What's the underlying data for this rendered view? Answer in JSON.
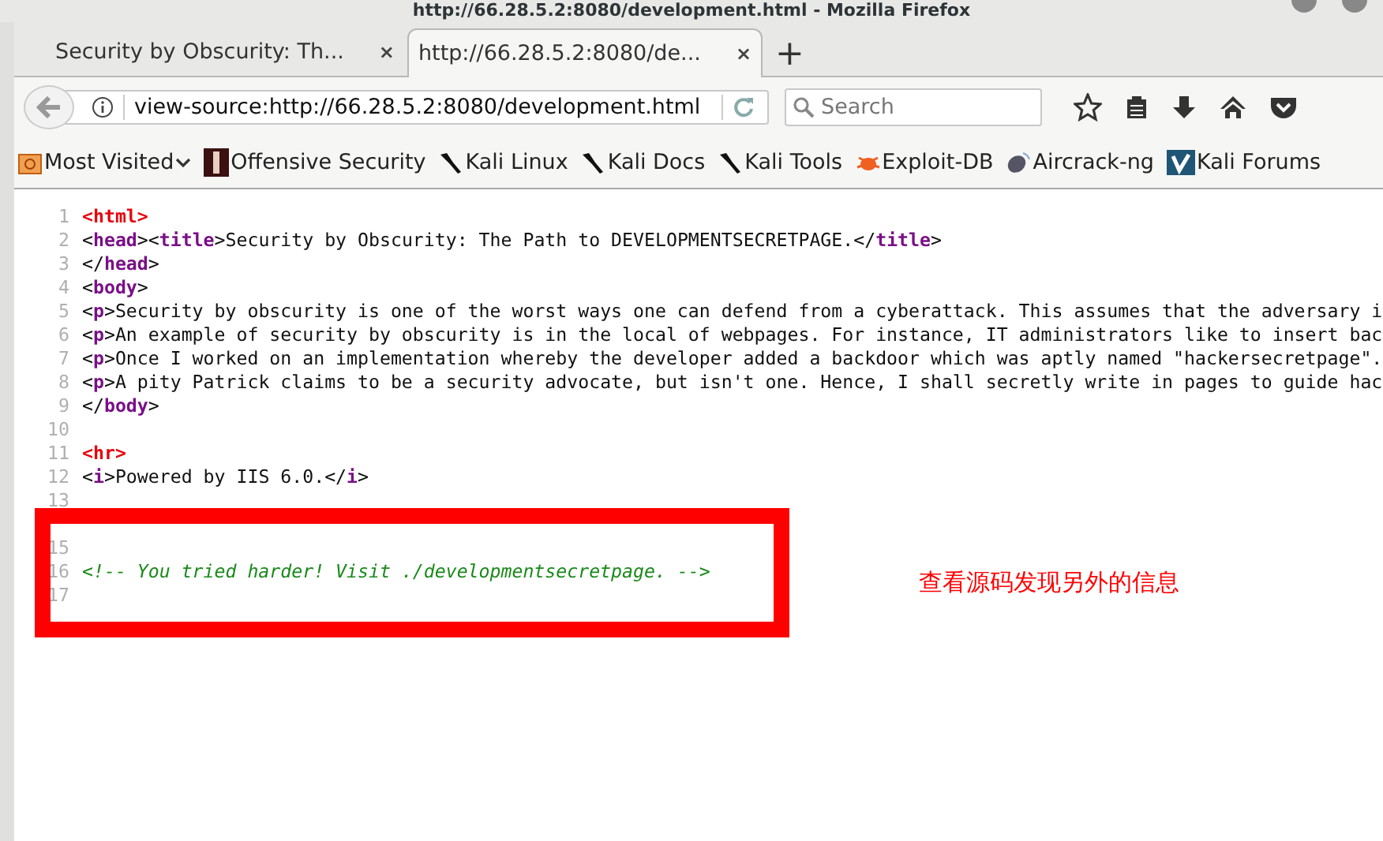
{
  "window": {
    "title": "http://66.28.5.2:8080/development.html - Mozilla Firefox"
  },
  "tabs": [
    {
      "label": "Security by Obscurity: Th...",
      "close": "×",
      "selected": false
    },
    {
      "label": "http://66.28.5.2:8080/de...",
      "close": "×",
      "selected": true
    }
  ],
  "new_tab": "+",
  "address_bar": {
    "value": "view-source:http://66.28.5.2:8080/development.html"
  },
  "search": {
    "placeholder": "Search"
  },
  "bookmarks": [
    {
      "label": "Most Visited",
      "kind": "folder"
    },
    {
      "label": "Offensive Security",
      "kind": "offsec"
    },
    {
      "label": "Kali Linux",
      "kind": "kali"
    },
    {
      "label": "Kali Docs",
      "kind": "kali"
    },
    {
      "label": "Kali Tools",
      "kind": "kali"
    },
    {
      "label": "Exploit-DB",
      "kind": "bug"
    },
    {
      "label": "Aircrack-ng",
      "kind": "aircrack"
    },
    {
      "label": "Kali Forums",
      "kind": "forum"
    }
  ],
  "source_lines": [
    {
      "number": "1",
      "tokens": [
        {
          "kind": "special",
          "text": "<html>"
        }
      ]
    },
    {
      "number": "2",
      "tokens": [
        {
          "kind": "punct",
          "text": "<"
        },
        {
          "kind": "tag",
          "text": "head"
        },
        {
          "kind": "punct",
          "text": "><"
        },
        {
          "kind": "tag",
          "text": "title"
        },
        {
          "kind": "punct",
          "text": ">Security by Obscurity: The Path to DEVELOPMENTSECRETPAGE.</"
        },
        {
          "kind": "tag",
          "text": "title"
        },
        {
          "kind": "punct",
          "text": ">"
        }
      ]
    },
    {
      "number": "3",
      "tokens": [
        {
          "kind": "punct",
          "text": "</"
        },
        {
          "kind": "tag",
          "text": "head"
        },
        {
          "kind": "punct",
          "text": ">"
        }
      ]
    },
    {
      "number": "4",
      "tokens": [
        {
          "kind": "punct",
          "text": "<"
        },
        {
          "kind": "tag",
          "text": "body"
        },
        {
          "kind": "punct",
          "text": ">"
        }
      ]
    },
    {
      "number": "5",
      "tokens": [
        {
          "kind": "punct",
          "text": "<"
        },
        {
          "kind": "tag",
          "text": "p"
        },
        {
          "kind": "punct",
          "text": ">Security by obscurity is one of the worst ways one can defend from a cyberattack. This assumes that the adversary i"
        }
      ]
    },
    {
      "number": "6",
      "tokens": [
        {
          "kind": "punct",
          "text": "<"
        },
        {
          "kind": "tag",
          "text": "p"
        },
        {
          "kind": "punct",
          "text": ">An example of security by obscurity is in the local of webpages. For instance, IT administrators like to insert bac"
        }
      ]
    },
    {
      "number": "7",
      "tokens": [
        {
          "kind": "punct",
          "text": "<"
        },
        {
          "kind": "tag",
          "text": "p"
        },
        {
          "kind": "punct",
          "text": ">Once I worked on an implementation whereby the developer added a backdoor which was aptly named \"hackersecretpage\"."
        }
      ]
    },
    {
      "number": "8",
      "tokens": [
        {
          "kind": "punct",
          "text": "<"
        },
        {
          "kind": "tag",
          "text": "p"
        },
        {
          "kind": "punct",
          "text": ">A pity Patrick claims to be a security advocate, but isn't one. Hence, I shall secretly write in pages to guide hac"
        }
      ]
    },
    {
      "number": "9",
      "tokens": [
        {
          "kind": "punct",
          "text": "</"
        },
        {
          "kind": "tag",
          "text": "body"
        },
        {
          "kind": "punct",
          "text": ">"
        }
      ]
    },
    {
      "number": "10"
    },
    {
      "number": "11",
      "tokens": [
        {
          "kind": "special",
          "text": "<hr>"
        }
      ]
    },
    {
      "number": "12",
      "tokens": [
        {
          "kind": "punct",
          "text": "<"
        },
        {
          "kind": "tag",
          "text": "i"
        },
        {
          "kind": "punct",
          "text": ">Powered by IIS 6.0.</"
        },
        {
          "kind": "tag",
          "text": "i"
        },
        {
          "kind": "punct",
          "text": ">"
        }
      ]
    },
    {
      "number": "13"
    },
    {
      "covered": true
    },
    {
      "number": "15"
    },
    {
      "number": "16",
      "tokens": [
        {
          "kind": "comment",
          "text": "<!-- You tried harder! Visit ./developmentsecretpage. -->"
        }
      ]
    },
    {
      "number": "17"
    }
  ],
  "annotation": {
    "text": "查看源码发现另外的信息"
  }
}
